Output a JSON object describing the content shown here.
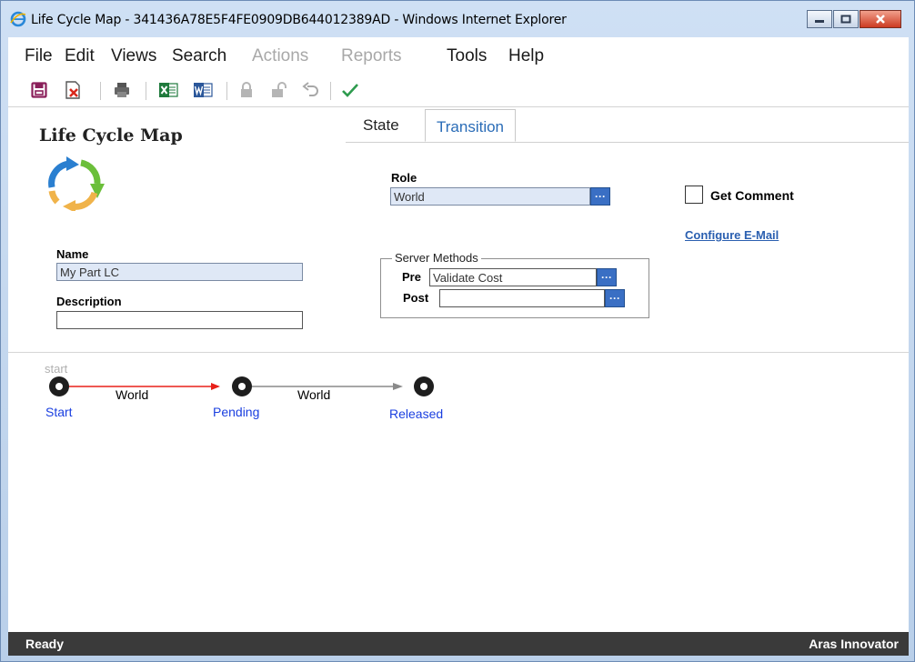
{
  "window": {
    "title": "Life Cycle Map - 341436A78E5F4FE0909DB644012389AD - Windows Internet Explorer"
  },
  "menu": {
    "items": [
      {
        "label": "File",
        "enabled": true
      },
      {
        "label": "Edit",
        "enabled": true
      },
      {
        "label": "Views",
        "enabled": true
      },
      {
        "label": "Search",
        "enabled": true
      },
      {
        "label": "Actions",
        "enabled": false
      },
      {
        "label": "Reports",
        "enabled": false
      },
      {
        "label": "Tools",
        "enabled": true
      },
      {
        "label": "Help",
        "enabled": true
      }
    ]
  },
  "toolbar": {
    "icons": [
      "save-icon",
      "close-item-icon",
      "print-icon",
      "export-excel-icon",
      "export-word-icon",
      "lock-icon",
      "unlock-icon",
      "undo-icon",
      "done-icon"
    ]
  },
  "form": {
    "title": "Life Cycle Map",
    "name_label": "Name",
    "name_value": "My Part LC",
    "description_label": "Description",
    "description_value": ""
  },
  "tabs": [
    {
      "label": "State",
      "active": false
    },
    {
      "label": "Transition",
      "active": true
    }
  ],
  "transition": {
    "role_label": "Role",
    "role_value": "World",
    "server_methods_label": "Server Methods",
    "pre_label": "Pre",
    "pre_value": "Validate Cost",
    "post_label": "Post",
    "post_value": "",
    "get_comment_label": "Get Comment",
    "get_comment_checked": false,
    "configure_email_label": "Configure E-Mail",
    "lookup_glyph": "···"
  },
  "diagram": {
    "start_caption": "start",
    "states": [
      {
        "label": "Start"
      },
      {
        "label": "Pending"
      },
      {
        "label": "Released"
      }
    ],
    "transitions": [
      {
        "label": "World",
        "from": "Start",
        "to": "Pending",
        "selected": true
      },
      {
        "label": "World",
        "from": "Pending",
        "to": "Released",
        "selected": false
      }
    ]
  },
  "status": {
    "left": "Ready",
    "right": "Aras Innovator"
  },
  "colors": {
    "accent_blue": "#3a6fc4",
    "tab_active_text": "#2a6cb7",
    "state_label": "#1a3fe0",
    "selected_transition": "#e8201a",
    "transition": "#8a8a8a",
    "status_bar": "#3a3a3a"
  }
}
